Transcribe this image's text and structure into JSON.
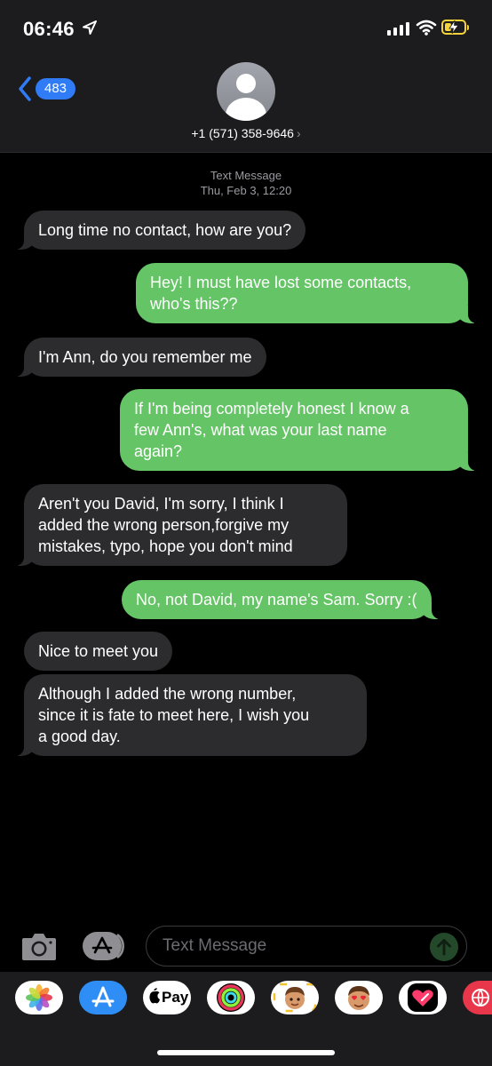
{
  "status": {
    "time": "06:46",
    "battery_level": 0.35
  },
  "header": {
    "back_count": "483",
    "contact": "+1 (571) 358-9646",
    "chevron": "›"
  },
  "timestamp": {
    "label": "Text Message",
    "date": "Thu, Feb 3, 12:20"
  },
  "messages": [
    {
      "from": "them",
      "lines": [
        "Long time no contact, how are you?"
      ]
    },
    {
      "from": "me",
      "lines": [
        "Hey! I must have lost some contacts,",
        "who's this??"
      ]
    },
    {
      "from": "them",
      "lines": [
        "I'm Ann, do you remember me"
      ]
    },
    {
      "from": "me",
      "lines": [
        "If I'm being completely honest I know a",
        "few Ann's, what was your last name",
        "again?"
      ]
    },
    {
      "from": "them",
      "lines": [
        "Aren't you David, I'm sorry, I think I",
        "added the wrong person,forgive my",
        "mistakes, typo, hope you don't mind"
      ]
    },
    {
      "from": "me",
      "lines": [
        "No, not David, my name's Sam. Sorry :("
      ]
    },
    {
      "from": "them",
      "lines": [
        "Nice to meet you"
      ]
    },
    {
      "from": "them",
      "lines": [
        "Although I added the wrong number,",
        "since it is fate to meet here, I wish you",
        "a good day."
      ]
    }
  ],
  "composer": {
    "placeholder": "Text Message"
  },
  "drawer": {
    "apple_pay_label": "Pay",
    "apps": [
      "photos-icon",
      "app-store-icon",
      "apple-pay-icon",
      "activity-icon",
      "memoji-icon",
      "memoji-stickers-icon",
      "digital-touch-icon",
      "web-search-icon"
    ]
  },
  "colors": {
    "sent_bubble": "#65c466",
    "received_bubble": "#2c2c2e",
    "accent": "#2f7cf6"
  }
}
